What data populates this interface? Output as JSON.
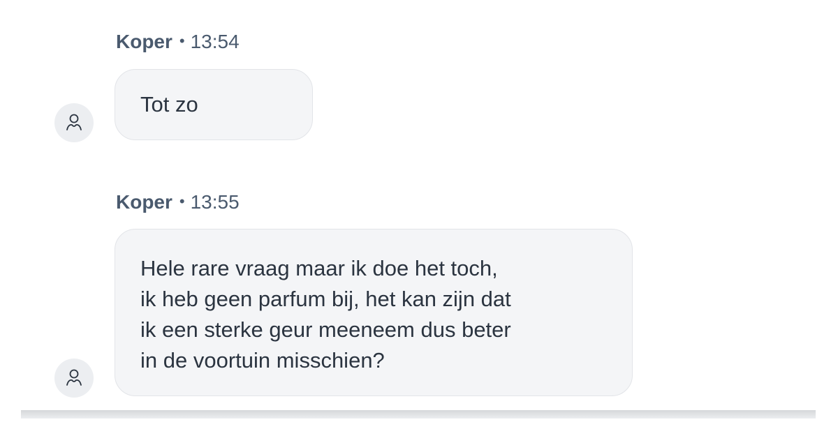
{
  "messages": [
    {
      "sender": "Koper",
      "separator": "•",
      "time": "13:54",
      "text": "Tot zo"
    },
    {
      "sender": "Koper",
      "separator": "•",
      "time": "13:55",
      "text": "Hele rare vraag maar ik doe het toch,\nik heb geen parfum bij, het kan zijn dat\nik een sterke geur meeneem dus beter\nin de voortuin misschien?"
    }
  ],
  "icons": {
    "avatar": "user-avatar-icon"
  },
  "colors": {
    "bubble_bg": "#f4f5f7",
    "meta_text": "#4a5a6e",
    "message_text": "#2b3440",
    "avatar_bg": "#eceef1"
  }
}
